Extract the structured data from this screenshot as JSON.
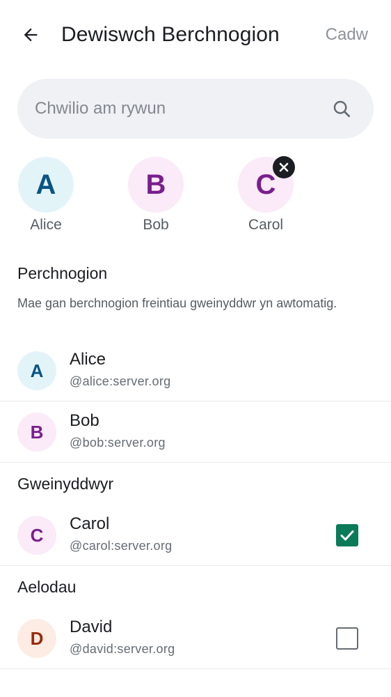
{
  "header": {
    "title": "Dewiswch Berchnogion",
    "save_label": "Cadw",
    "back_icon": "arrow-left-icon"
  },
  "search": {
    "placeholder": "Chwilio am rywun",
    "value": "",
    "icon": "search-icon"
  },
  "selected_chips": [
    {
      "initial": "A",
      "name": "Alice",
      "bg": "#e3f4f9",
      "fg": "#0a5386",
      "removable": false
    },
    {
      "initial": "B",
      "name": "Bob",
      "bg": "#fbeaf7",
      "fg": "#7a1e8e",
      "removable": false
    },
    {
      "initial": "C",
      "name": "Carol",
      "bg": "#fbeaf7",
      "fg": "#7a1e8e",
      "removable": true
    }
  ],
  "sections": {
    "owners": {
      "title": "Perchnogion",
      "description": "Mae gan berchnogion freintiau gweinyddwr yn awtomatig.",
      "members": [
        {
          "initial": "A",
          "name": "Alice",
          "handle": "@alice:server.org",
          "bg": "#e3f4f9",
          "fg": "#0a5386"
        },
        {
          "initial": "B",
          "name": "Bob",
          "handle": "@bob:server.org",
          "bg": "#fbeaf7",
          "fg": "#7a1e8e"
        }
      ]
    },
    "admins": {
      "title": "Gweinyddwyr",
      "members": [
        {
          "initial": "C",
          "name": "Carol",
          "handle": "@carol:server.org",
          "bg": "#fbeaf7",
          "fg": "#7a1e8e",
          "checked": true
        }
      ]
    },
    "members": {
      "title": "Aelodau",
      "members": [
        {
          "initial": "D",
          "name": "David",
          "handle": "@david:server.org",
          "bg": "#fdece4",
          "fg": "#9a2a0b",
          "checked": false
        }
      ]
    }
  },
  "colors": {
    "accent": "#0b7a58",
    "muted_text": "#8d9399",
    "divider": "#e8eaed",
    "search_bg": "#eff1f5"
  }
}
